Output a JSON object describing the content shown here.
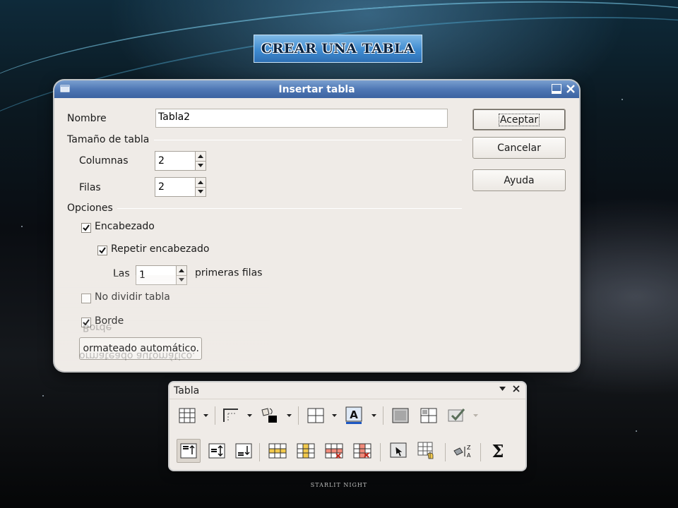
{
  "banner": {
    "title": "CREAR UNA TABLA"
  },
  "dialog": {
    "title": "Insertar tabla",
    "name_label": "Nombre",
    "name_value": "Tabla2",
    "size_section": "Tamaño de tabla",
    "columns_label": "Columnas",
    "columns_value": "2",
    "rows_label": "Filas",
    "rows_value": "2",
    "options_section": "Opciones",
    "header_label": "Encabezado",
    "header_checked": true,
    "repeat_header_label": "Repetir encabezado",
    "repeat_header_checked": true,
    "the_label": "Las",
    "first_rows_value": "1",
    "first_rows_suffix": "primeras filas",
    "no_split_label": "No dividir tabla",
    "no_split_checked": false,
    "border_label": "Borde",
    "border_checked": true,
    "autoformat_button": "ormateado automático.",
    "ok_button": "Aceptar",
    "cancel_button": "Cancelar",
    "help_button": "Ayuda"
  },
  "toolbar": {
    "title": "Tabla",
    "row1_icons": [
      "table-icon",
      "borders-icon",
      "border-color-icon",
      "cell-borders-icon",
      "background-color-icon",
      "merge-cells-icon",
      "split-cells-icon",
      "table-properties-icon"
    ],
    "row2_icons": [
      "align-top-icon",
      "center-vertical-icon",
      "align-bottom-icon",
      "insert-row-icon",
      "insert-column-icon",
      "delete-row-icon",
      "delete-column-icon",
      "select-table-icon",
      "optimize-icon",
      "sort-icon",
      "sum-icon"
    ],
    "sum_symbol": "Σ"
  },
  "watermark": {
    "line1": "STARLIT NIGHT"
  },
  "colors": {
    "titlebar": "#4f78b5",
    "banner": "#3f8bd0",
    "dialog_bg": "#efebe7"
  }
}
